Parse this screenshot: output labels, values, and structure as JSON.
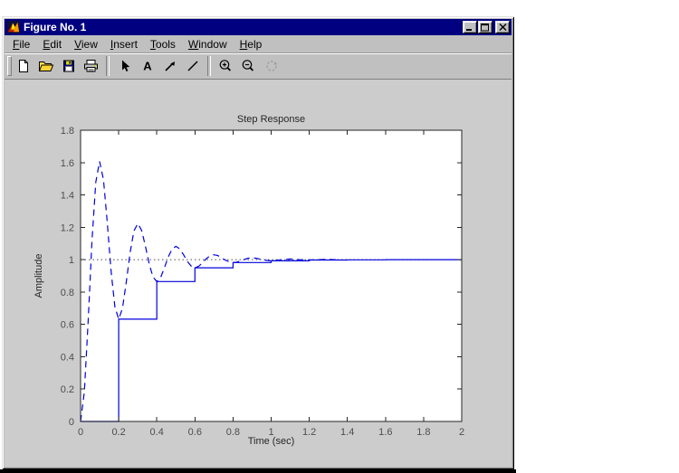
{
  "window": {
    "title": "Figure No. 1",
    "icon": "matlab-logo",
    "controls": [
      "minimize",
      "maximize",
      "close"
    ]
  },
  "menu": {
    "items": [
      {
        "label": "File",
        "underline": 0
      },
      {
        "label": "Edit",
        "underline": 0
      },
      {
        "label": "View",
        "underline": 0
      },
      {
        "label": "Insert",
        "underline": 0
      },
      {
        "label": "Tools",
        "underline": 0
      },
      {
        "label": "Window",
        "underline": 0
      },
      {
        "label": "Help",
        "underline": 0
      }
    ]
  },
  "toolbar": {
    "buttons": [
      "new-figure",
      "open-file",
      "save-figure",
      "print-figure",
      "pointer",
      "add-text",
      "add-arrow",
      "add-line",
      "zoom-in",
      "zoom-out",
      "rotate-3d"
    ],
    "disabled": [
      "rotate-3d"
    ]
  },
  "colors": {
    "titlebar": "#000080",
    "chrome": "#c0c0c0",
    "figure_background": "#cccccc",
    "plot_background": "#ffffff",
    "line_blue": "#0000dd",
    "reference_gray": "#4d4d4d"
  },
  "chart_data": {
    "type": "line",
    "title": "Step Response",
    "xlabel": "Time (sec)",
    "ylabel": "Amplitude",
    "xlim": [
      0,
      2
    ],
    "ylim": [
      0,
      1.8
    ],
    "xticks": [
      0,
      0.2,
      0.4,
      0.6,
      0.8,
      1,
      1.2,
      1.4,
      1.6,
      1.8,
      2
    ],
    "xtick_labels": [
      "0",
      "0.2",
      "0.4",
      "0.6",
      "0.8",
      "1",
      "1.2",
      "1.4",
      "1.6",
      "1.8",
      "2"
    ],
    "yticks": [
      0,
      0.2,
      0.4,
      0.6,
      0.8,
      1,
      1.2,
      1.4,
      1.6,
      1.8
    ],
    "ytick_labels": [
      "0",
      "0.2",
      "0.4",
      "0.6",
      "0.8",
      "1",
      "1.2",
      "1.4",
      "1.6",
      "1.8"
    ],
    "grid": false,
    "legend": null,
    "reference_line": {
      "y": 1,
      "style": "dotted",
      "color": "#4d4d4d"
    },
    "series": [
      {
        "name": "continuous-step-response",
        "line_style": "dashed",
        "color": "#0000dd",
        "x": [
          0,
          0.02,
          0.04,
          0.06,
          0.08,
          0.1,
          0.12,
          0.14,
          0.16,
          0.18,
          0.2,
          0.22,
          0.24,
          0.26,
          0.28,
          0.3,
          0.32,
          0.34,
          0.36,
          0.38,
          0.4,
          0.42,
          0.44,
          0.46,
          0.48,
          0.5,
          0.52,
          0.54,
          0.56,
          0.58,
          0.6,
          0.62,
          0.64,
          0.66,
          0.68,
          0.7,
          0.72,
          0.74,
          0.76,
          0.78,
          0.8,
          0.82,
          0.84,
          0.86,
          0.88,
          0.9,
          0.92,
          0.94,
          0.96,
          0.98,
          1,
          1.05,
          1.1,
          1.15,
          1.2,
          1.25,
          1.3,
          1.35
        ],
        "y": [
          0.0,
          0.184,
          0.623,
          1.117,
          1.479,
          1.607,
          1.495,
          1.229,
          0.929,
          0.709,
          0.632,
          0.7,
          0.862,
          1.043,
          1.177,
          1.223,
          1.182,
          1.084,
          0.974,
          0.893,
          0.865,
          0.89,
          0.949,
          1.016,
          1.065,
          1.082,
          1.067,
          1.031,
          0.99,
          0.961,
          0.95,
          0.959,
          0.981,
          1.006,
          1.024,
          1.03,
          1.025,
          1.011,
          0.997,
          0.986,
          0.982,
          0.985,
          0.993,
          1.002,
          1.009,
          1.011,
          1.009,
          1.004,
          0.999,
          0.995,
          0.993,
          0.999,
          1.004,
          1.0,
          0.998,
          1.0,
          1.002,
          0.999
        ]
      },
      {
        "name": "discretized-step-response-zoh",
        "line_style": "stairs-solid",
        "color": "#0000dd",
        "step_times": [
          0,
          0.2,
          0.4,
          0.6,
          0.8,
          1,
          1.2,
          1.4,
          1.6,
          1.8
        ],
        "step_values": [
          0,
          0.632,
          0.865,
          0.95,
          0.982,
          0.993,
          0.998,
          0.999,
          1,
          1
        ],
        "end_time": 2
      }
    ]
  }
}
